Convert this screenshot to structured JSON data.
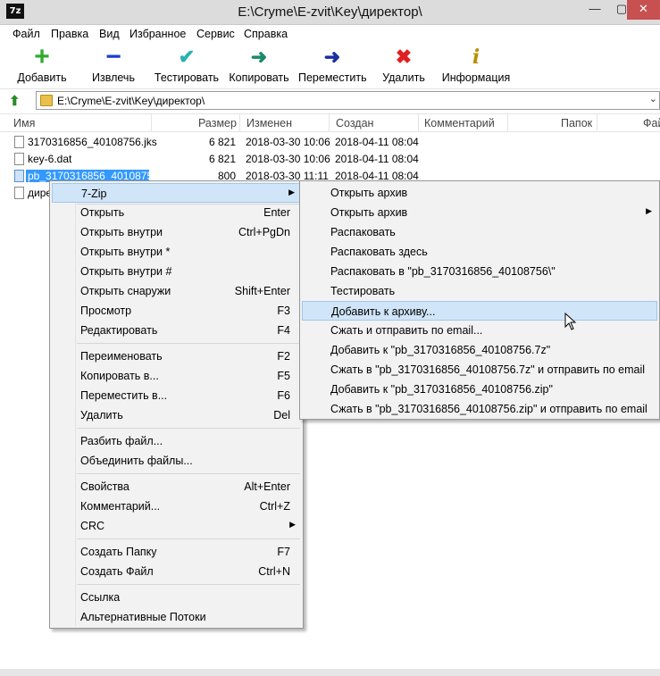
{
  "window": {
    "app_icon": "7z",
    "title": "E:\\Cryme\\E-zvit\\Key\\директор\\",
    "min_icon": "minimize-icon",
    "max_icon": "maximize-icon",
    "close_icon": "close-icon"
  },
  "menubar": [
    "Файл",
    "Правка",
    "Вид",
    "Избранное",
    "Сервис",
    "Справка"
  ],
  "toolbar": [
    {
      "label": "Добавить",
      "icon": "plus-icon",
      "glyph": "+",
      "color": "#2eaa2e"
    },
    {
      "label": "Извлечь",
      "icon": "minus-icon",
      "glyph": "−",
      "color": "#1a3fd0"
    },
    {
      "label": "Тестировать",
      "icon": "check-icon",
      "glyph": "✔",
      "color": "#2bb0b0"
    },
    {
      "label": "Копировать",
      "icon": "copy-arrow-icon",
      "glyph": "➜",
      "color": "#1a8a6a"
    },
    {
      "label": "Переместить",
      "icon": "move-arrow-icon",
      "glyph": "➜",
      "color": "#1a2fa0"
    },
    {
      "label": "Удалить",
      "icon": "delete-x-icon",
      "glyph": "✖",
      "color": "#e02020"
    },
    {
      "label": "Информация",
      "icon": "info-icon",
      "glyph": "i",
      "color": "#b89000"
    }
  ],
  "address": {
    "path": "E:\\Cryme\\E-zvit\\Key\\директор\\"
  },
  "columns": [
    "Имя",
    "Размер",
    "Изменен",
    "Создан",
    "Комментарий",
    "Папок",
    "Фай"
  ],
  "files": [
    {
      "name": "3170316856_40108756.jks",
      "size": "6 821",
      "modified": "2018-03-30 10:06",
      "created": "2018-04-11 08:04"
    },
    {
      "name": "key-6.dat",
      "size": "6 821",
      "modified": "2018-03-30 10:06",
      "created": "2018-04-11 08:04"
    },
    {
      "name": "pb_3170316856_40108756",
      "size": "800",
      "modified": "2018-03-30 11:11",
      "created": "2018-04-11 08:04"
    },
    {
      "name": "дире",
      "size": "",
      "modified": "",
      "created": ""
    }
  ],
  "context_menu": [
    {
      "label": "7-Zip",
      "key": "",
      "submenu": true
    },
    {
      "label": "Открыть",
      "key": "Enter"
    },
    {
      "label": "Открыть внутри",
      "key": "Ctrl+PgDn"
    },
    {
      "label": "Открыть внутри *",
      "key": ""
    },
    {
      "label": "Открыть внутри #",
      "key": ""
    },
    {
      "label": "Открыть снаружи",
      "key": "Shift+Enter"
    },
    {
      "label": "Просмотр",
      "key": "F3"
    },
    {
      "label": "Редактировать",
      "key": "F4"
    },
    {
      "label": "Переименовать",
      "key": "F2"
    },
    {
      "label": "Копировать в...",
      "key": "F5"
    },
    {
      "label": "Переместить в...",
      "key": "F6"
    },
    {
      "label": "Удалить",
      "key": "Del"
    },
    {
      "label": "Разбить файл...",
      "key": ""
    },
    {
      "label": "Объединить файлы...",
      "key": ""
    },
    {
      "label": "Свойства",
      "key": "Alt+Enter"
    },
    {
      "label": "Комментарий...",
      "key": "Ctrl+Z"
    },
    {
      "label": "CRC",
      "key": "",
      "submenu": true
    },
    {
      "label": "Создать Папку",
      "key": "F7"
    },
    {
      "label": "Создать Файл",
      "key": "Ctrl+N"
    },
    {
      "label": "Ссылка",
      "key": ""
    },
    {
      "label": "Альтернативные Потоки",
      "key": ""
    }
  ],
  "submenu_7zip": [
    {
      "label": "Открыть архив"
    },
    {
      "label": "Открыть архив",
      "submenu": true
    },
    {
      "label": "Распаковать"
    },
    {
      "label": "Распаковать здесь"
    },
    {
      "label": "Распаковать в \"pb_3170316856_40108756\\\""
    },
    {
      "label": "Тестировать"
    },
    {
      "label": "Добавить к архиву..."
    },
    {
      "label": "Сжать и отправить по email..."
    },
    {
      "label": "Добавить к \"pb_3170316856_40108756.7z\""
    },
    {
      "label": "Сжать в \"pb_3170316856_40108756.7z\" и отправить по email"
    },
    {
      "label": "Добавить к \"pb_3170316856_40108756.zip\""
    },
    {
      "label": "Сжать в \"pb_3170316856_40108756.zip\" и отправить по email"
    }
  ],
  "submenu_arrow": "▶"
}
